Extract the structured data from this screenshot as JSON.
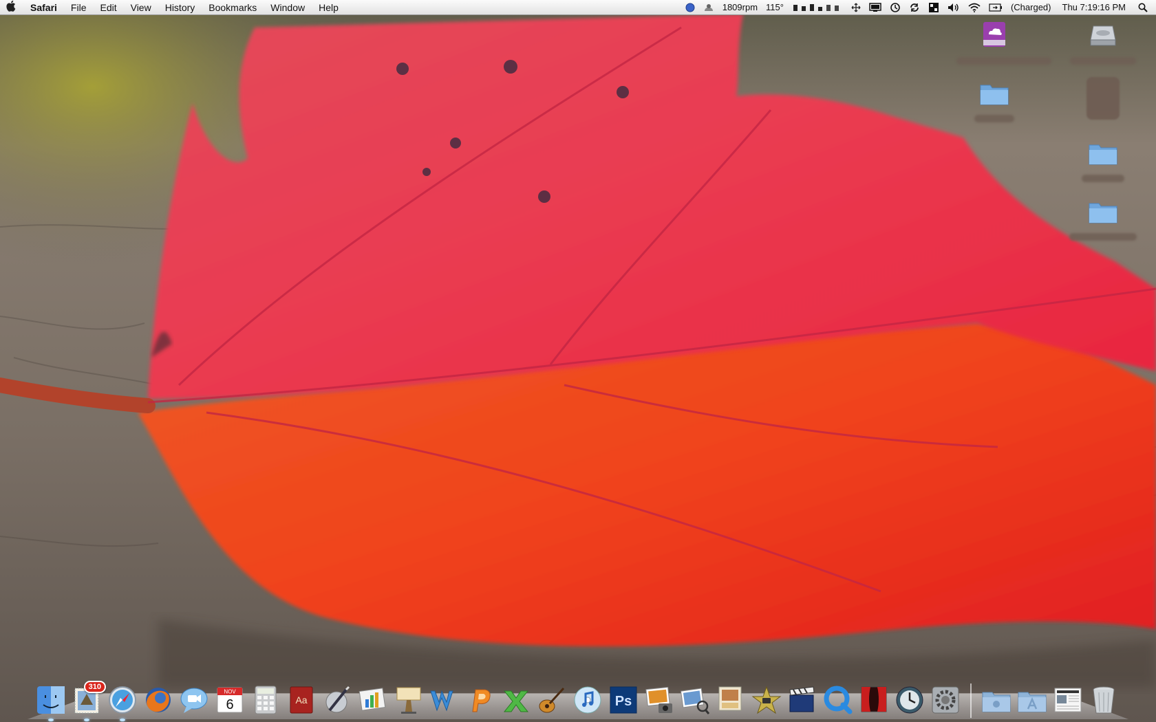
{
  "menubar": {
    "app_name": "Safari",
    "menus": [
      "File",
      "Edit",
      "View",
      "History",
      "Bookmarks",
      "Window",
      "Help"
    ],
    "status": {
      "fan_speed": "1809rpm",
      "temperature": "115°",
      "battery": "(Charged)",
      "clock": "Thu 7:19:16 PM"
    }
  },
  "dock": {
    "mail_badge": "310",
    "calendar_month": "NOV",
    "calendar_day": "6",
    "photoshop_label": "Ps",
    "dictionary_label": "Aa",
    "items": [
      "Finder",
      "Mail",
      "Safari",
      "Firefox",
      "iChat",
      "iCal",
      "Calculator",
      "Dictionary",
      "Script Editor",
      "Keynote",
      "Keynote Presenter",
      "Word",
      "PowerPoint",
      "Excel",
      "GarageBand",
      "iTunes",
      "Photoshop",
      "iPhoto",
      "Preview",
      "Photo Booth",
      "iMovie",
      "Final Cut",
      "QuickTime",
      "DVD Player",
      "Time Machine",
      "System Preferences",
      "Documents",
      "Applications",
      "Downloads",
      "Trash"
    ]
  },
  "colors": {
    "menubar_bg": "#ececec",
    "leaf_red": "#e8344a",
    "leaf_orange": "#f0581c",
    "wood": "#7d7064",
    "folder_blue": "#7fb3e3"
  }
}
